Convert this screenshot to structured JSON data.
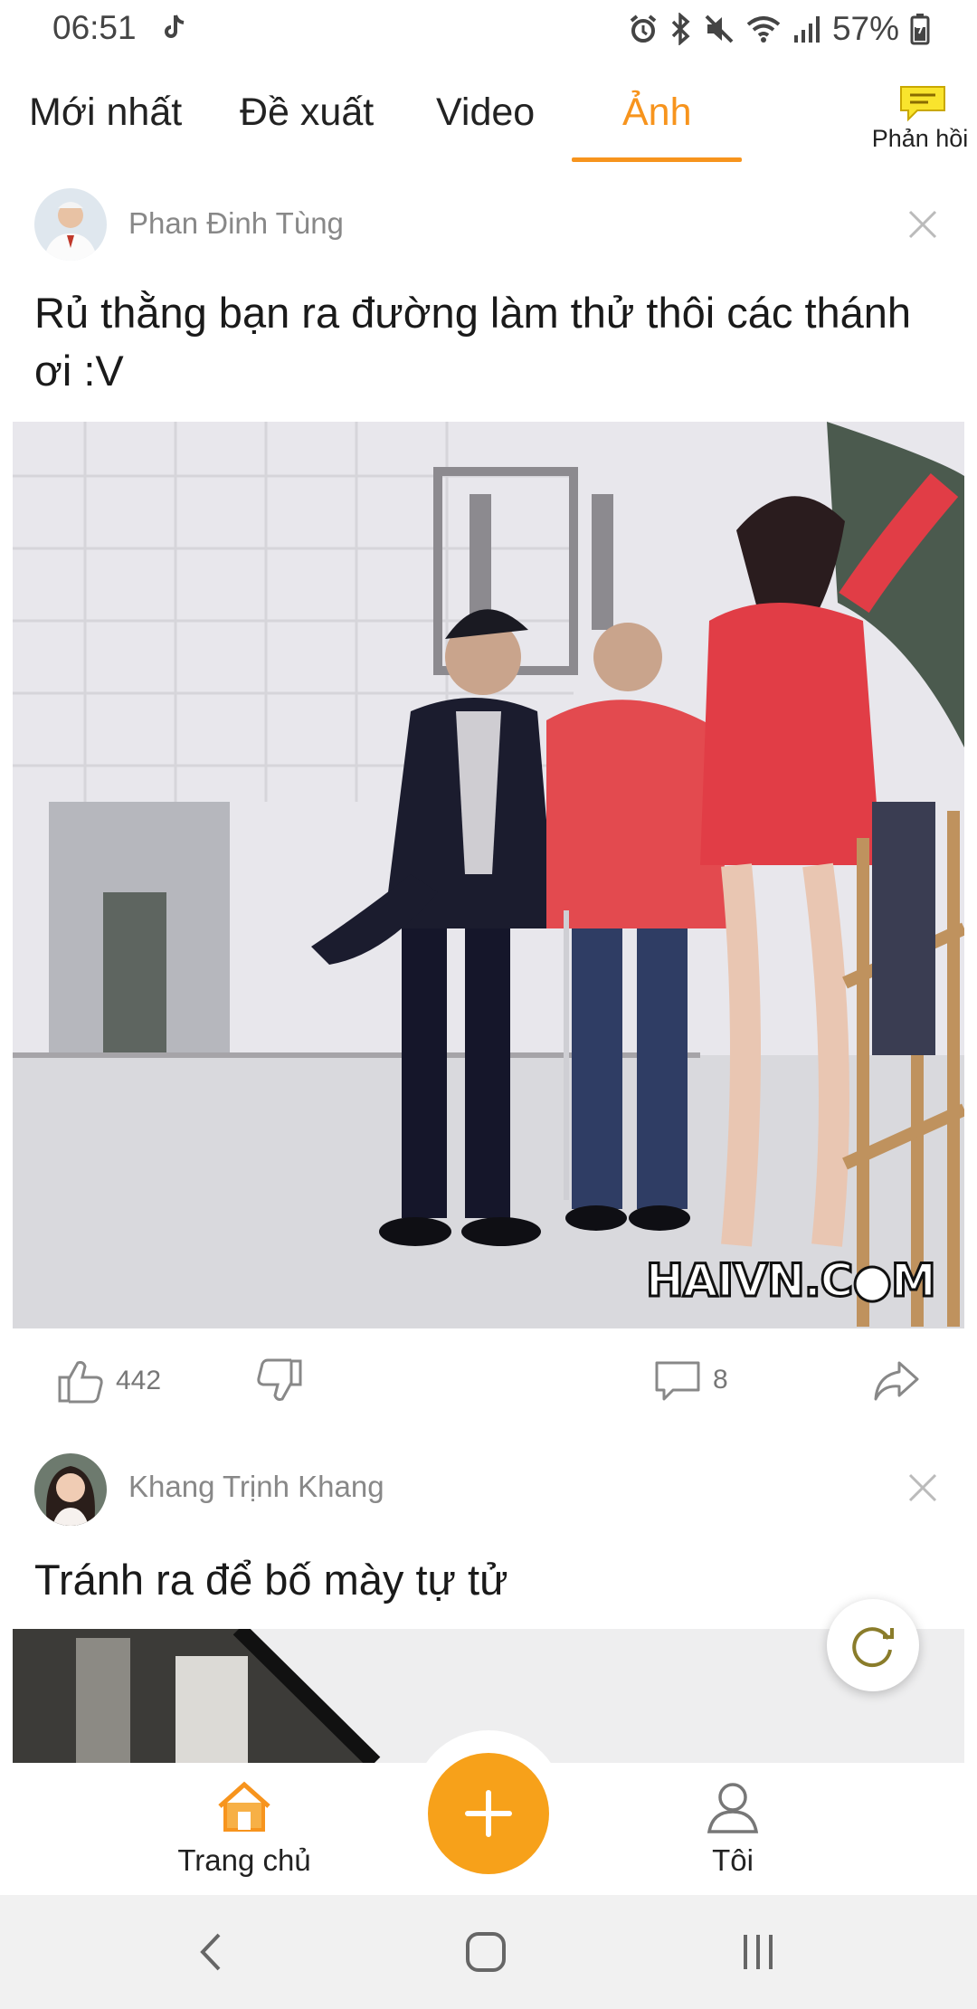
{
  "status_bar": {
    "time": "06:51",
    "battery_percent": "57%",
    "icons": [
      "tiktok-icon",
      "alarm-icon",
      "bluetooth-icon",
      "mute-icon",
      "wifi-icon",
      "signal-icon",
      "battery-icon"
    ]
  },
  "tabs": [
    {
      "label": "Mới nhất",
      "active": false
    },
    {
      "label": "Đề xuất",
      "active": false
    },
    {
      "label": "Video",
      "active": false
    },
    {
      "label": "Ảnh",
      "active": true
    }
  ],
  "feedback": {
    "label": "Phản hồi"
  },
  "posts": [
    {
      "author": "Phan Đinh Tùng",
      "title": "Rủ thằng bạn ra đường làm thử thôi các thánh ơi :V",
      "image_watermark": "HAIVN.C●M",
      "likes": "442",
      "comments": "8"
    },
    {
      "author": "Khang Trịnh Khang",
      "title": "Tránh ra để bố mày tự tử"
    }
  ],
  "bottom_nav": {
    "home_label": "Trang chủ",
    "me_label": "Tôi",
    "add_button": "+"
  },
  "colors": {
    "accent": "#f7941d",
    "fab": "#f7a11a",
    "muted_text": "#888888"
  }
}
